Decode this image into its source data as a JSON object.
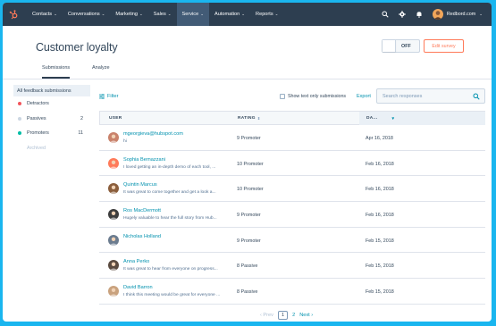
{
  "nav": {
    "items": [
      {
        "label": "Contacts",
        "active": false
      },
      {
        "label": "Conversations",
        "active": false
      },
      {
        "label": "Marketing",
        "active": false
      },
      {
        "label": "Sales",
        "active": false
      },
      {
        "label": "Service",
        "active": true
      },
      {
        "label": "Automation",
        "active": false
      },
      {
        "label": "Reports",
        "active": false
      }
    ],
    "account": "Redbord.com"
  },
  "header": {
    "title": "Customer loyalty",
    "toggle_label": "OFF",
    "edit_label": "Edit survey",
    "tabs": [
      "Submissions",
      "Analyze"
    ]
  },
  "sidebar": {
    "heading": "All feedback submissions",
    "items": [
      {
        "label": "Detractors",
        "count": "",
        "color": "#f2545b"
      },
      {
        "label": "Passives",
        "count": "2",
        "color": "#cbd6e2"
      },
      {
        "label": "Promoters",
        "count": "11",
        "color": "#00bda5"
      },
      {
        "label": "Archived",
        "count": "",
        "color": ""
      }
    ]
  },
  "toolbar": {
    "filter": "Filter",
    "show_text": "Show text only submissions",
    "export": "Export",
    "search_placeholder": "Search responses"
  },
  "table": {
    "headers": {
      "user": "USER",
      "rating": "RATING",
      "date": "DA..."
    },
    "rows": [
      {
        "name": "mgeorgieva@hubspot.com",
        "msg": "hi",
        "rating": "9 Promoter",
        "date": "Apr 16, 2018",
        "avatar": "#c9826b"
      },
      {
        "name": "Sophia Bernazzani",
        "msg": "I loved getting an in-depth demo of each tool, ...",
        "rating": "10 Promoter",
        "date": "Feb 16, 2018",
        "avatar": "#ff7a59"
      },
      {
        "name": "Quintin Marcus",
        "msg": "It was great to come together and get a look a...",
        "rating": "10 Promoter",
        "date": "Feb 16, 2018",
        "avatar": "#8b5e3c"
      },
      {
        "name": "Ros MacDermott",
        "msg": "Hugely valuable to hear the full story from Hub...",
        "rating": "9 Promoter",
        "date": "Feb 16, 2018",
        "avatar": "#3d3d3d"
      },
      {
        "name": "Nicholas Holland",
        "msg": "",
        "rating": "9 Promoter",
        "date": "Feb 15, 2018",
        "avatar": "#6b7c8f"
      },
      {
        "name": "Anna Perko",
        "msg": "It was great to hear from everyone on progress...",
        "rating": "8 Passive",
        "date": "Feb 15, 2018",
        "avatar": "#5a4a3f"
      },
      {
        "name": "David Barron",
        "msg": "I think this meeting would be great for everyone ...",
        "rating": "8 Passive",
        "date": "Feb 15, 2018",
        "avatar": "#c9a27e"
      }
    ]
  },
  "pager": {
    "prev": "Prev",
    "pages": [
      "1",
      "2"
    ],
    "current": "1",
    "next": "Next"
  }
}
